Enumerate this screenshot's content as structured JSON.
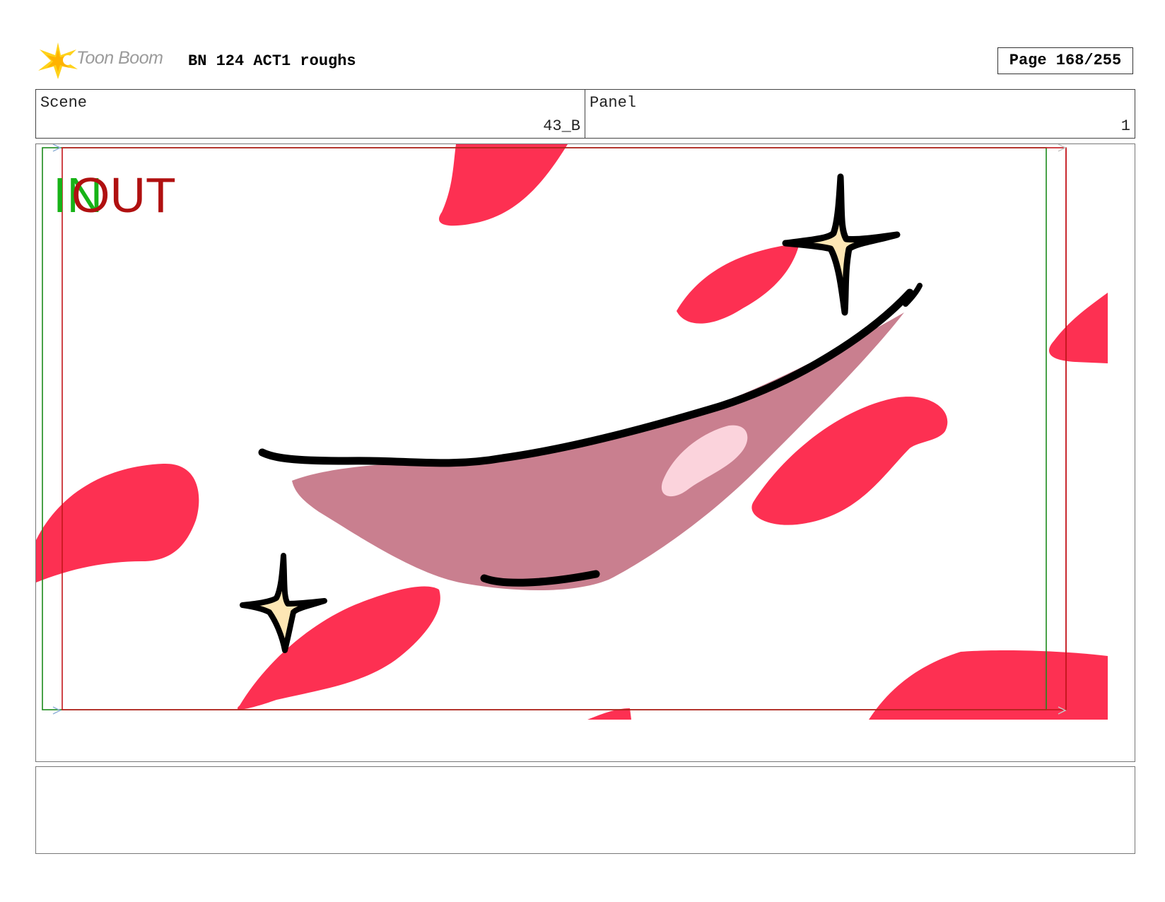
{
  "header": {
    "logo_text": "Toon Boom",
    "title": "BN 124 ACT1 roughs",
    "page_label": "Page 168/255"
  },
  "info": {
    "scene_label": "Scene",
    "scene_value": "43_B",
    "panel_label": "Panel",
    "panel_value": "1"
  },
  "panel": {
    "in_marker": "IN",
    "out_marker": "OUT",
    "colors": {
      "petal": "#fd3052",
      "mouth_fill": "#c97f8f",
      "tongue_highlight": "#fbd3dc",
      "sparkle_fill": "#fde6b4",
      "in_frame": "#1c8a1c",
      "out_frame": "#c3161c"
    }
  },
  "notes": {
    "text": ""
  }
}
